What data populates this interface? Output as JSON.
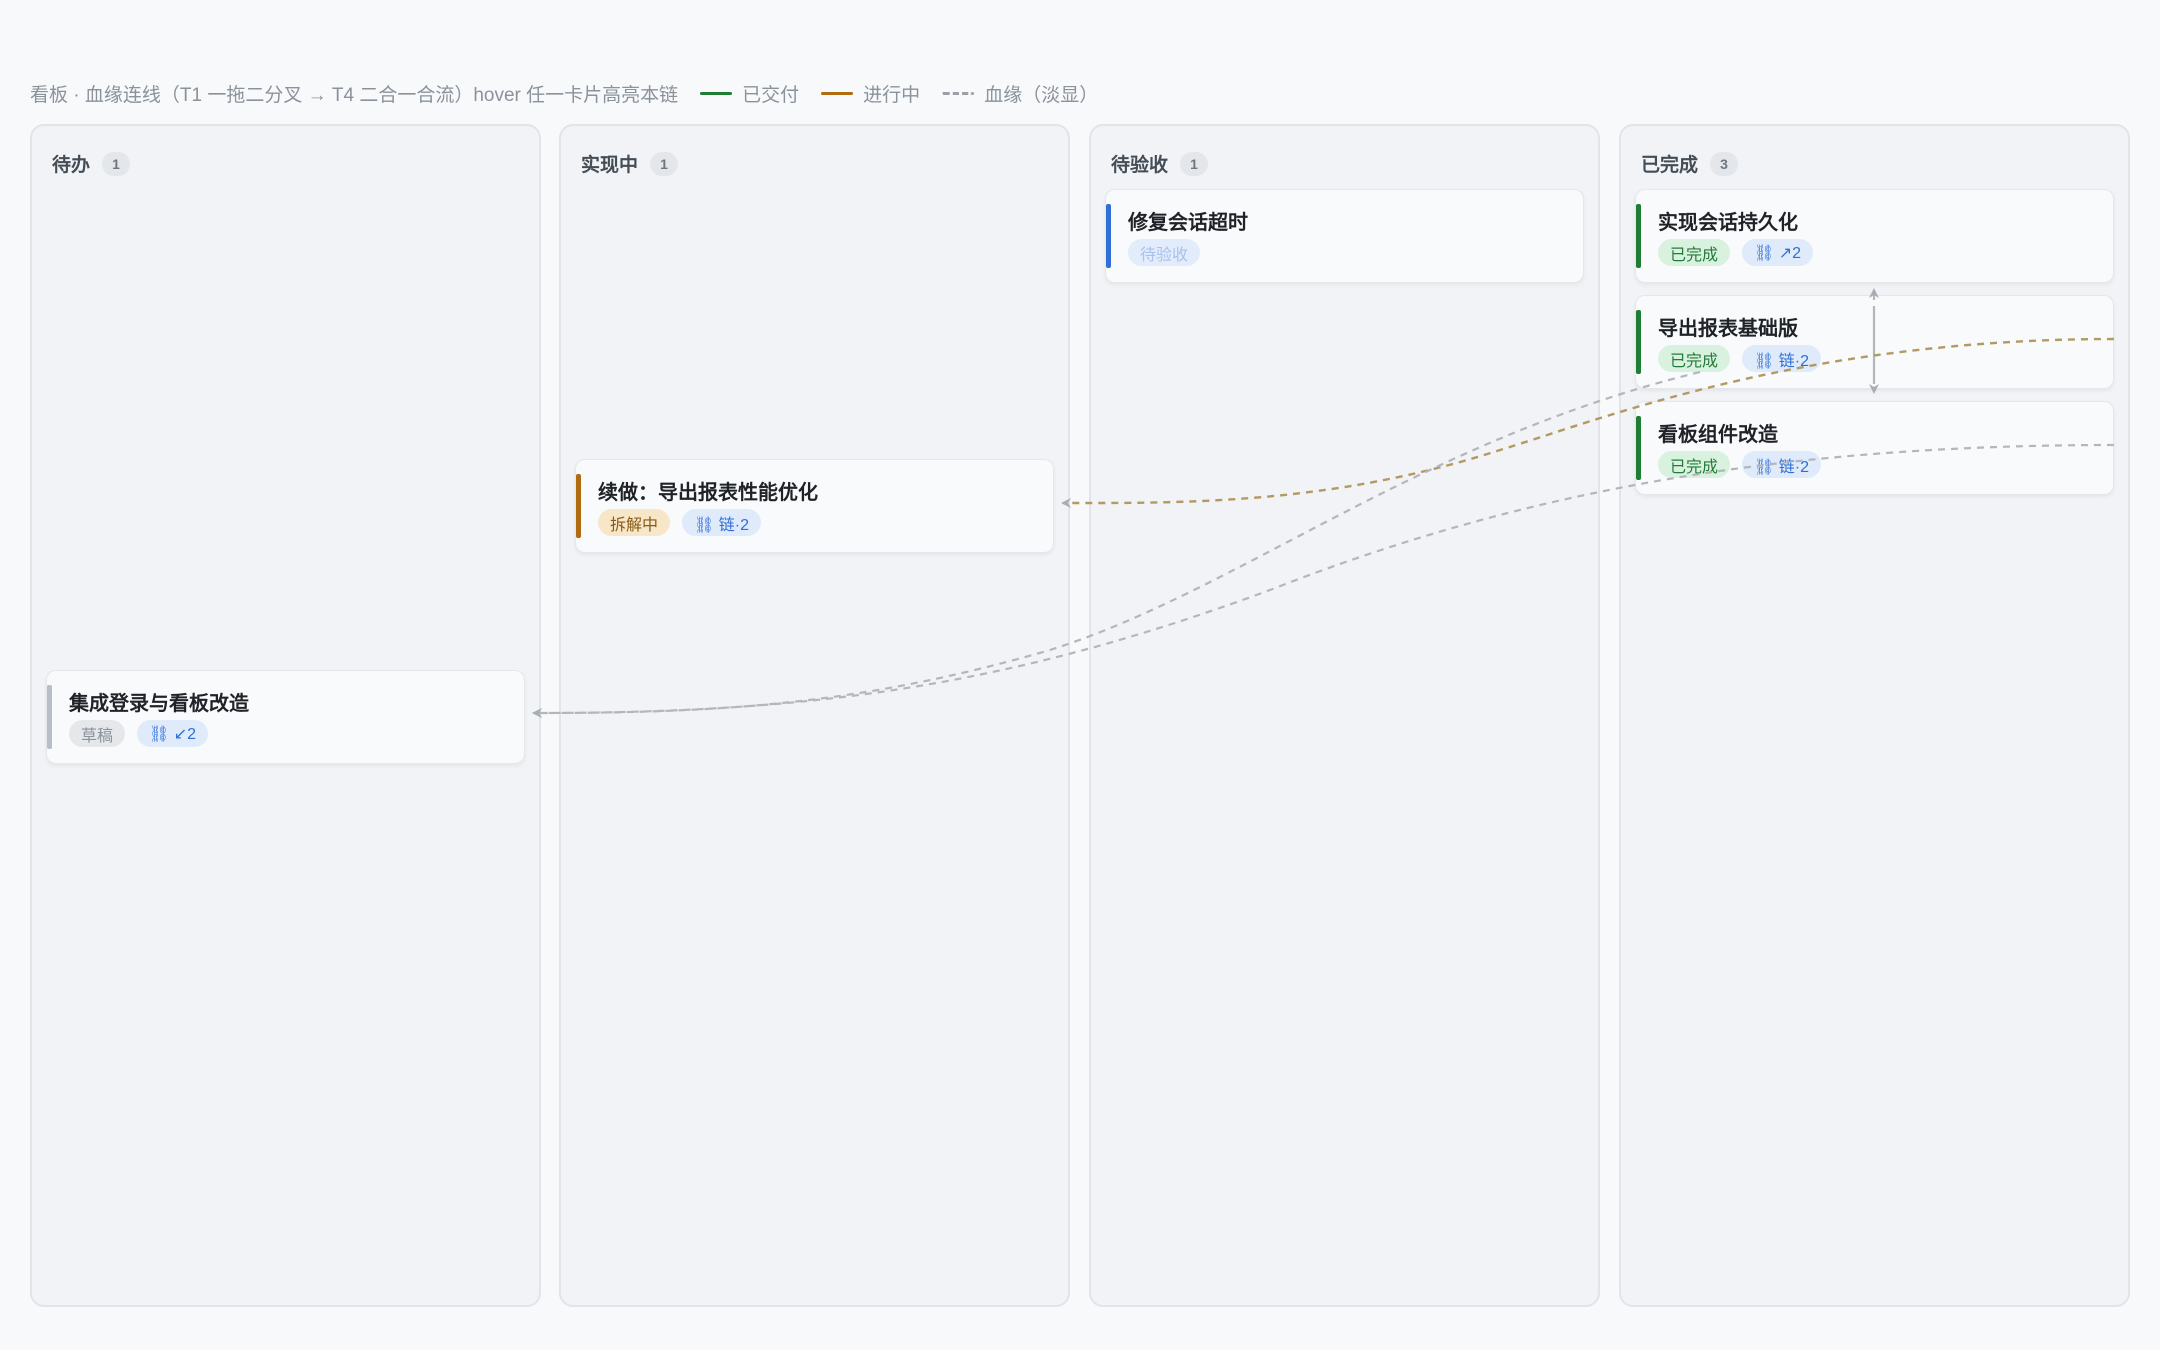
{
  "header": {
    "description": "看板 · 血缘连线（T1 一拖二分叉 → T4 二合一合流）hover 任一卡片高亮本链",
    "legend": [
      {
        "label": "已交付",
        "color": "#1e7e34",
        "style": "solid"
      },
      {
        "label": "进行中",
        "color": "#b06a10",
        "style": "solid"
      },
      {
        "label": "血缘（淡显）",
        "color": "#9aa0a6",
        "style": "dashed"
      }
    ]
  },
  "columns": [
    {
      "title": "待办",
      "count": "1"
    },
    {
      "title": "实现中",
      "count": "1"
    },
    {
      "title": "待验收",
      "count": "1"
    },
    {
      "title": "已完成",
      "count": "3"
    }
  ],
  "cards": {
    "backlog_1": {
      "title": "集成登录与看板改造",
      "status": "草稿",
      "link": "⛓ ↙2",
      "accent": "#b8bec6"
    },
    "wip_1": {
      "title": "续做：导出报表性能优化",
      "status": "拆解中",
      "link": "⛓ 链·2",
      "accent": "#b06a10"
    },
    "review_1": {
      "title": "修复会话超时",
      "status": "待验收",
      "accent": "#2f6fd8"
    },
    "done_1": {
      "title": "实现会话持久化",
      "status": "已完成",
      "link": "⛓ ↗2",
      "accent": "#1e7e34"
    },
    "done_2": {
      "title": "导出报表基础版",
      "status": "已完成",
      "link": "⛓ 链·2",
      "accent": "#1e7e34"
    },
    "done_3": {
      "title": "看板组件改造",
      "status": "已完成",
      "link": "⛓ 链·2",
      "accent": "#1e7e34"
    }
  },
  "colors": {
    "lineage_gray": "#b3b7bc",
    "lineage_progress": "#b39a62",
    "arrow_gray": "#a7adb4"
  }
}
